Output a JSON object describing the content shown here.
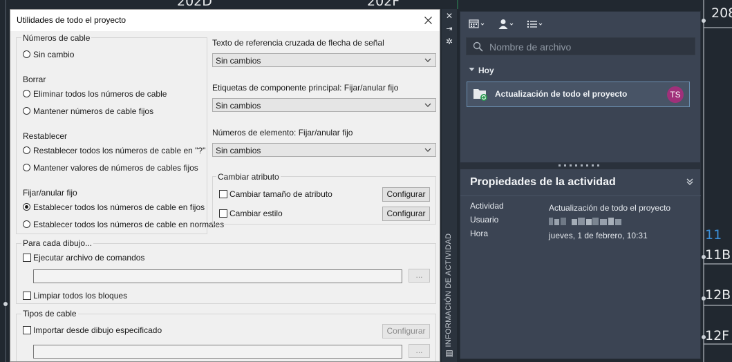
{
  "background": {
    "labels_top": [
      "202D",
      "202F"
    ],
    "labels_right": [
      "208",
      "11",
      "11B",
      "12B",
      "12F"
    ]
  },
  "dialog": {
    "title": "Utilidades de todo el proyecto",
    "cable_numbers": {
      "group_label": "Números de cable",
      "no_change": "Sin cambio"
    },
    "delete": {
      "label": "Borrar",
      "option_delete_all": "Eliminar todos los números de cable",
      "option_keep_fixed": "Mantener números de cable fijos"
    },
    "reset": {
      "label": "Restablecer",
      "option_reset_all": "Restablecer todos los números de cable en \"?\"",
      "option_keep_values": "Mantener valores de números de cables fijos"
    },
    "fix_unfix": {
      "label": "Fijar/anular fijo",
      "option_set_fixed": "Establecer todos los números de cable en fijos",
      "option_set_normal": "Establecer todos los números de cable en normales"
    },
    "signal_arrow": {
      "label": "Texto de referencia cruzada de flecha de señal",
      "value": "Sin cambios"
    },
    "parent_tags": {
      "label": "Etiquetas de componente principal: Fijar/anular fijo",
      "value": "Sin cambios"
    },
    "item_numbers": {
      "label": "Números de elemento: Fijar/anular fijo",
      "value": "Sin cambios"
    },
    "change_attribute": {
      "group_label": "Cambiar atributo",
      "resize_label": "Cambiar tamaño de atributo",
      "style_label": "Cambiar estilo",
      "configure_label": "Configurar"
    },
    "per_drawing": {
      "group_label": "Para cada dibujo...",
      "run_script_label": "Ejecutar archivo de comandos",
      "browse_label": "...",
      "purge_label": "Limpiar todos los bloques"
    },
    "wire_types": {
      "group_label": "Tipos de cable",
      "import_label": "Importar desde dibujo especificado",
      "configure_label": "Configurar",
      "browse_label": "..."
    }
  },
  "side_strip": {
    "label": "INFORMACIÓN DE ACTIVIDAD"
  },
  "panel": {
    "search_placeholder": "Nombre de archivo",
    "today_label": "Hoy",
    "activity_item": {
      "name": "Actualización de todo el proyecto",
      "avatar": "TS"
    },
    "properties": {
      "title": "Propiedades de la actividad",
      "activity_key": "Actividad",
      "activity_value": "Actualización de todo el proyecto",
      "user_key": "Usuario",
      "time_key": "Hora",
      "time_value": "jueves, 1 de febrero, 10:31"
    }
  },
  "colors": {
    "cad_background": "#212830",
    "dialog_background": "#f0f0f0",
    "panel_background": "#3b4453",
    "avatar": "#a0307a",
    "accent_blue": "#3c8fd8",
    "cad_green": "#2f8f5a"
  }
}
